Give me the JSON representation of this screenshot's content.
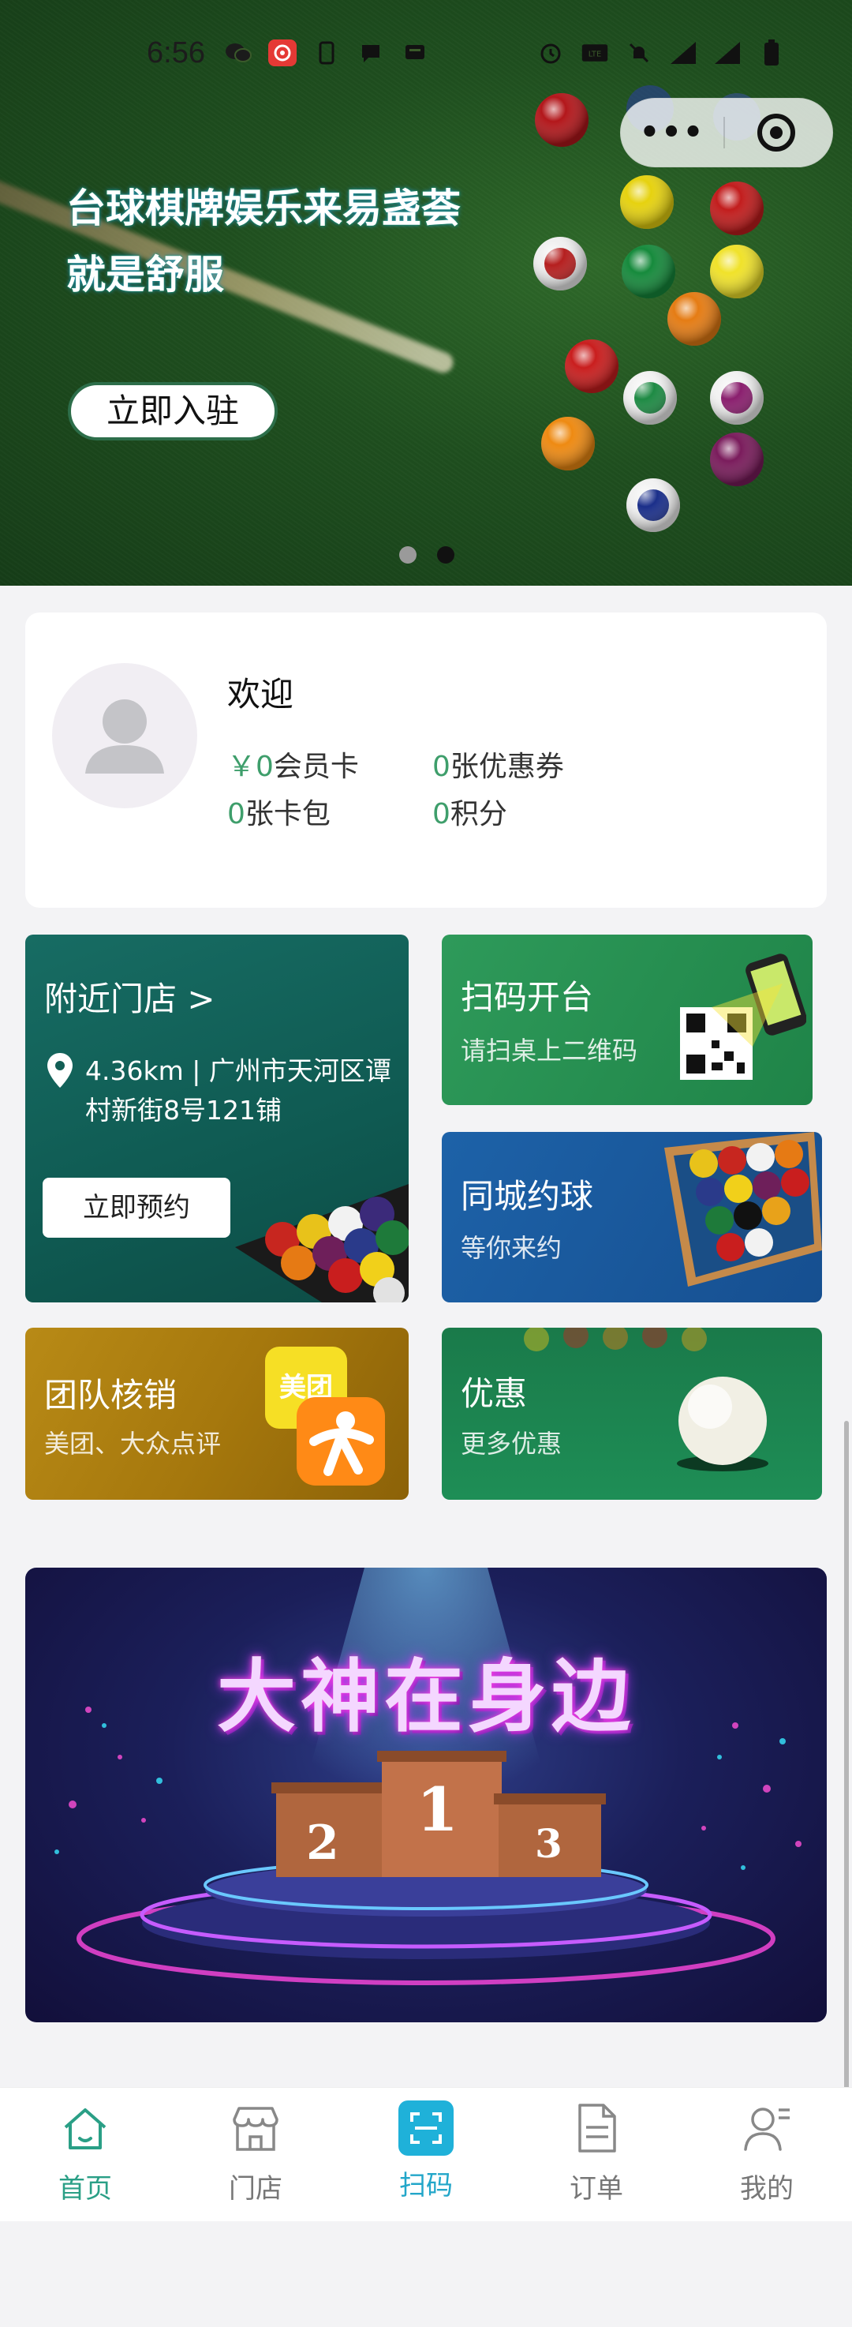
{
  "status_bar": {
    "time": "6:56",
    "icons": [
      "wechat-icon",
      "netease-music-icon",
      "sim-icon",
      "message-icon",
      "notification-icon",
      "alarm-icon",
      "volte-icon",
      "mute-icon",
      "signal-4g-icon",
      "signal-4g-icon",
      "battery-icon"
    ]
  },
  "capsule": {
    "more_icon": "more-dots-icon",
    "close_icon": "target-ring-icon"
  },
  "hero": {
    "title_line1": "台球棋牌娱乐来易盏荟",
    "title_line2": "就是舒服",
    "join_button": "立即入驻",
    "slides": 2,
    "active_slide": 2
  },
  "profile": {
    "welcome": "欢迎",
    "balance_prefix": "￥",
    "balance": "0",
    "balance_label": "会员卡",
    "coupons": "0",
    "coupons_label": "张优惠券",
    "cards": "0",
    "cards_label": "张卡包",
    "points": "0",
    "points_label": "积分",
    "accent_color": "#3e9e6b"
  },
  "tiles": {
    "nearby": {
      "title": "附近门店 >",
      "address": "4.36km | 广州市天河区谭村新街8号121铺",
      "book_button": "立即预约"
    },
    "scan": {
      "title": "扫码开台",
      "subtitle": "请扫桌上二维码"
    },
    "meet": {
      "title": "同城约球",
      "subtitle": "等你来约"
    },
    "team": {
      "title": "团队核销",
      "subtitle": "美团、大众点评",
      "badge": "美团"
    },
    "promo": {
      "title": "优惠",
      "subtitle": "更多优惠"
    }
  },
  "ranking_banner": {
    "title": "大神在身边",
    "podium": [
      "2",
      "1",
      "3"
    ]
  },
  "tabbar": {
    "items": [
      {
        "label": "首页",
        "icon": "home-icon"
      },
      {
        "label": "门店",
        "icon": "store-icon"
      },
      {
        "label": "扫码",
        "icon": "scan-icon"
      },
      {
        "label": "订单",
        "icon": "order-icon"
      },
      {
        "label": "我的",
        "icon": "user-icon"
      }
    ],
    "active_index": 0,
    "highlight_index": 2
  }
}
